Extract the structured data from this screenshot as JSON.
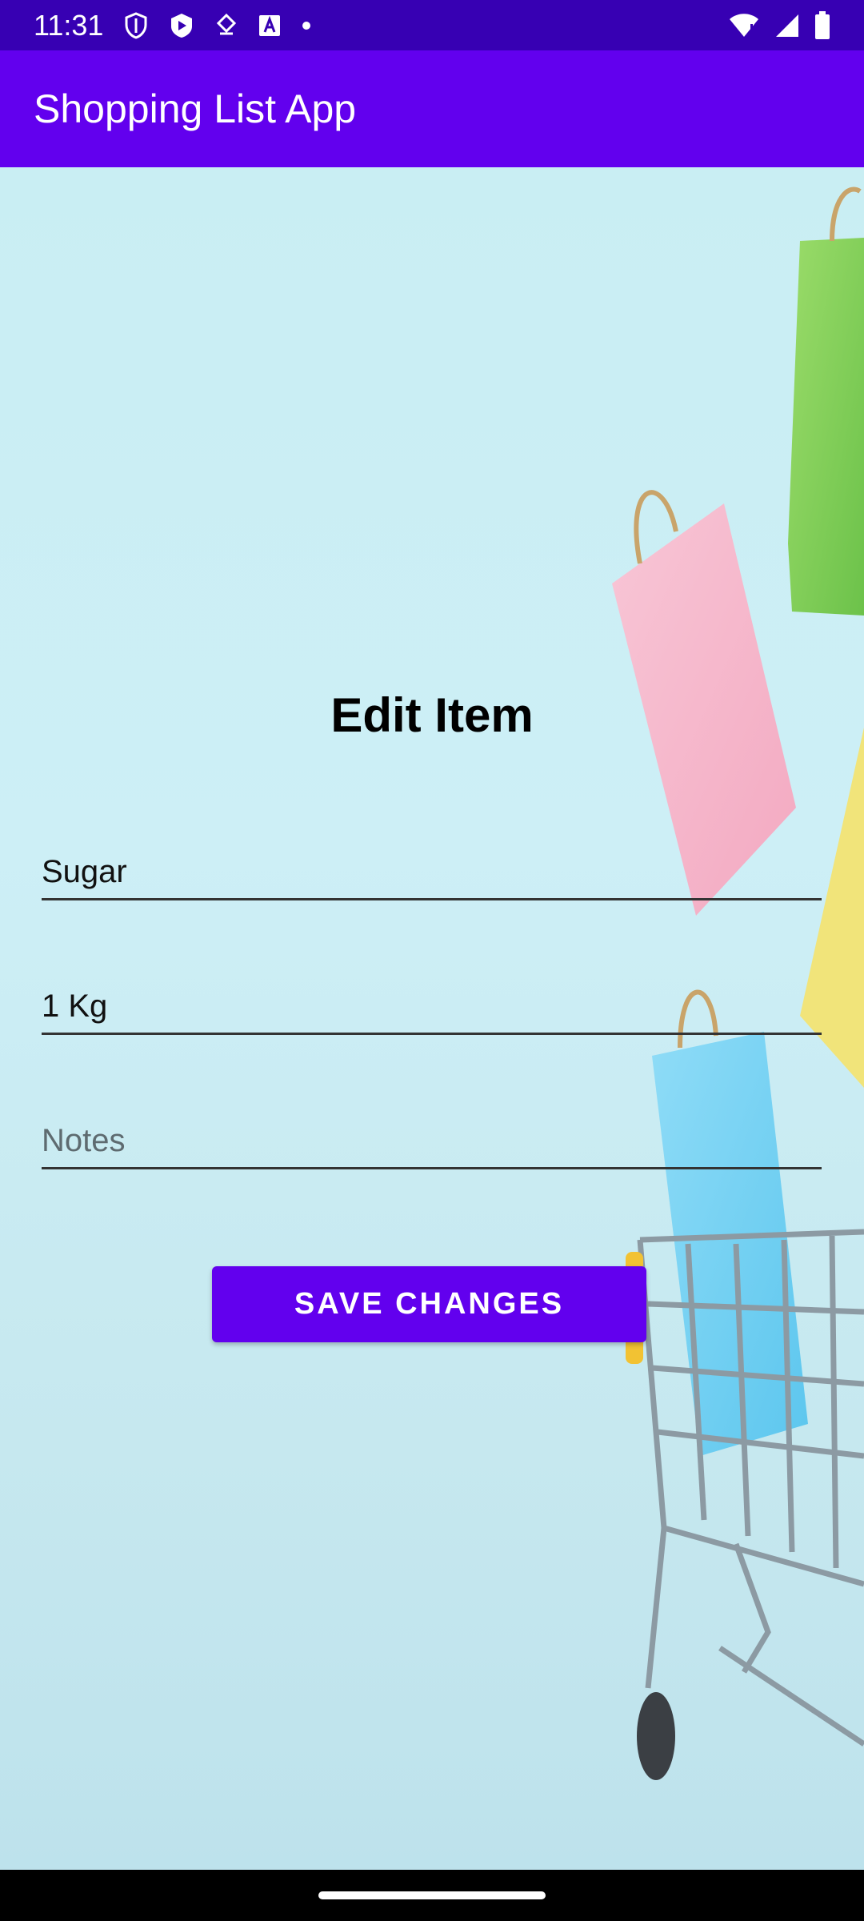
{
  "status_bar": {
    "time": "11:31",
    "icons": [
      "shield-icon",
      "play-icon",
      "signal-app-icon",
      "keyboard-a-icon",
      "dot-icon"
    ],
    "right_icons": [
      "wifi-icon",
      "cellular-icon",
      "battery-icon"
    ]
  },
  "app_bar": {
    "title": "Shopping List App"
  },
  "form": {
    "heading": "Edit Item",
    "name_value": "Sugar",
    "quantity_value": "1 Kg",
    "notes_value": "",
    "notes_placeholder": "Notes",
    "save_label": "SAVE CHANGES"
  },
  "colors": {
    "status_bar": "#3700B3",
    "app_bar": "#6200EE",
    "button": "#6200EE"
  }
}
